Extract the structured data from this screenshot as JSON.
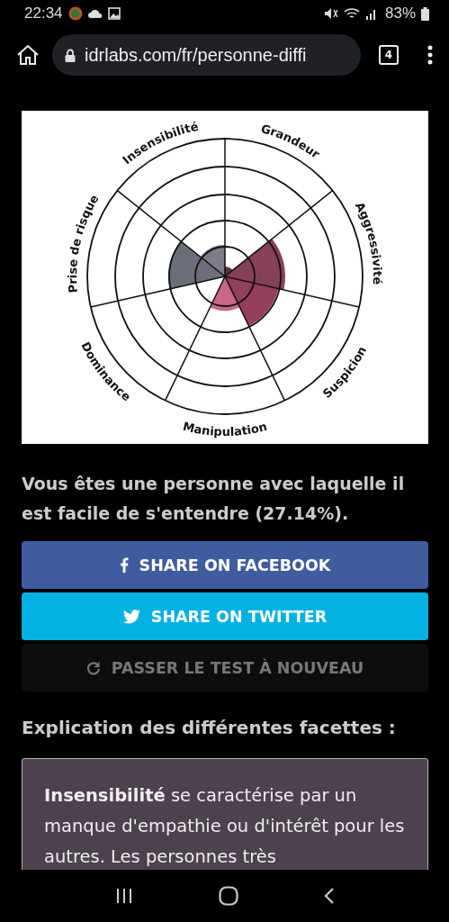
{
  "status_bar": {
    "time": "22:34",
    "battery": "83%"
  },
  "browser": {
    "url": "idrlabs.com/fr/personne-diffi",
    "tab_count": "4"
  },
  "chart": {
    "labels": [
      "Grandeur",
      "Aggressivité",
      "Suspicion",
      "Manipulation",
      "Dominance",
      "Prise de risque",
      "Insensibilité"
    ]
  },
  "result": "Vous êtes une personne avec laquelle il est facile de s'entendre (27.14%).",
  "buttons": [
    {
      "kind": "facebook",
      "label": "SHARE ON FACEBOOK"
    },
    {
      "kind": "twitter",
      "label": "SHARE ON TWITTER"
    },
    {
      "kind": "retry",
      "label": "PASSER LE TEST À NOUVEAU"
    }
  ],
  "section_heading": "Explication des différentes facettes :",
  "facet_text": "**Insensibilité** se caractérise par un manque d'empathie ou d'intérêt pour les autres. Les personnes très"
}
